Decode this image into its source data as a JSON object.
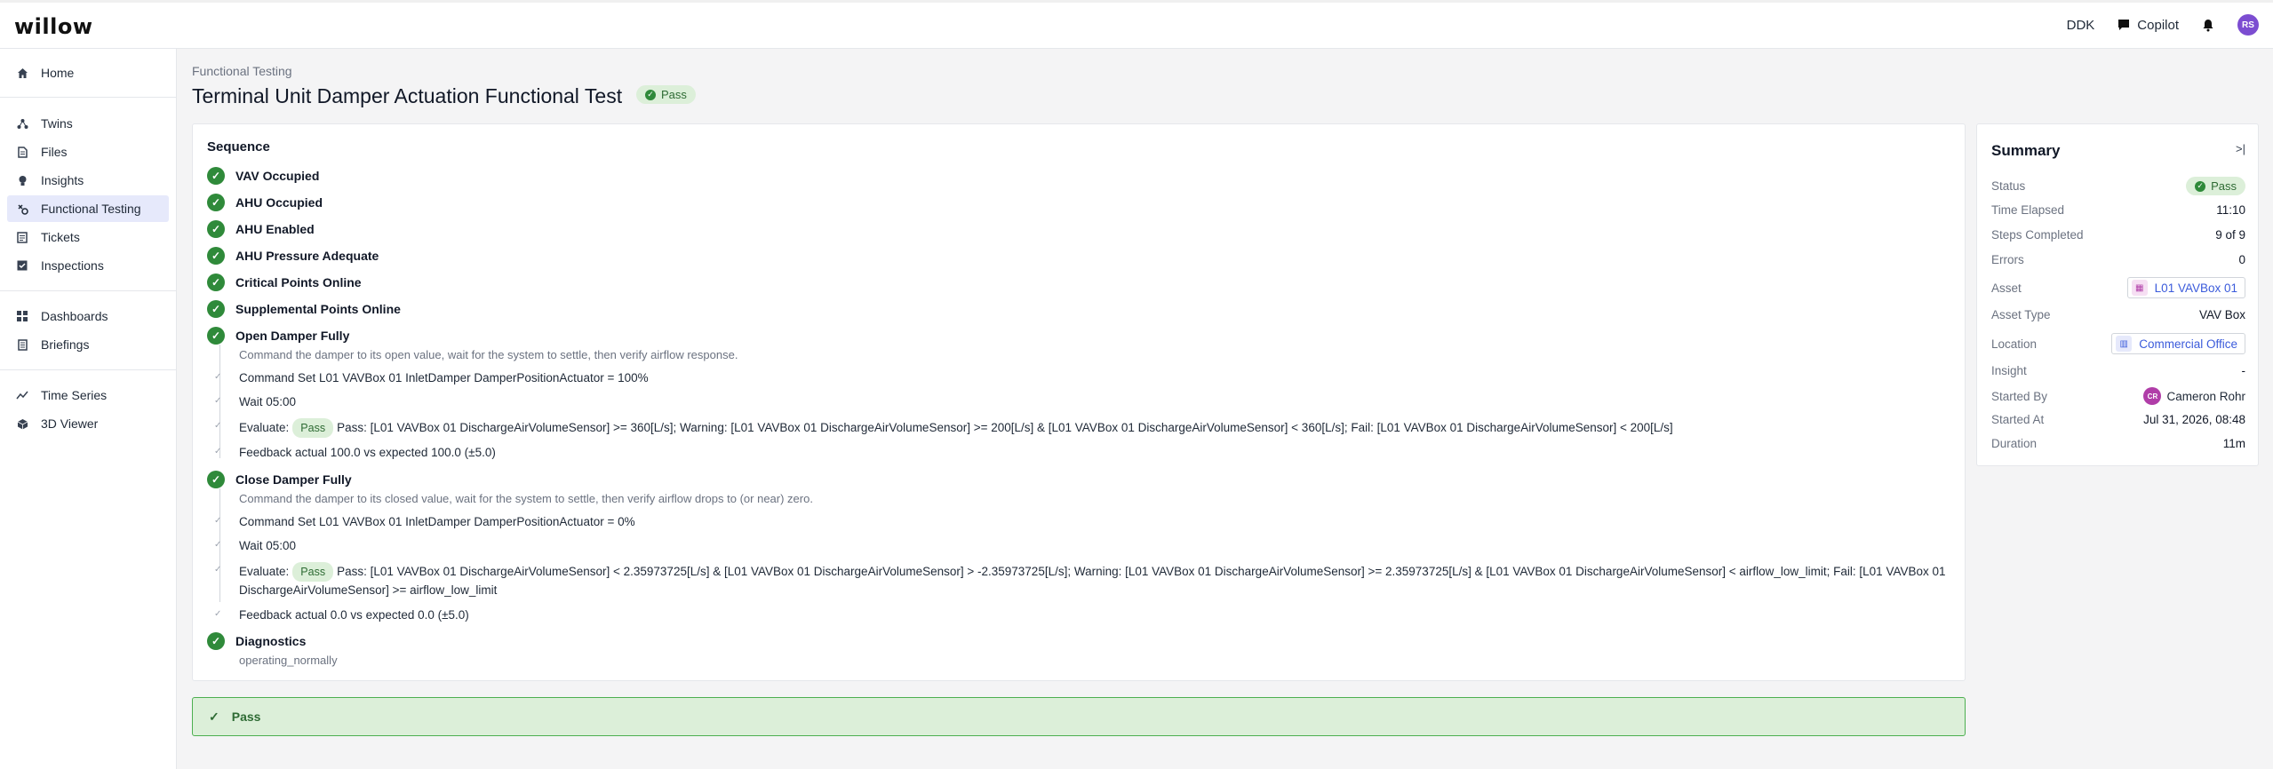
{
  "app": {
    "logo": "willow"
  },
  "topbar": {
    "site": "DDK",
    "copilot": "Copilot",
    "user_initials": "RS"
  },
  "sidebar": {
    "items": [
      {
        "label": "Home",
        "icon": "home-icon"
      },
      {
        "label": "Twins",
        "icon": "twins-icon"
      },
      {
        "label": "Files",
        "icon": "file-icon"
      },
      {
        "label": "Insights",
        "icon": "lightbulb-icon"
      },
      {
        "label": "Functional Testing",
        "icon": "functional-testing-icon",
        "active": true
      },
      {
        "label": "Tickets",
        "icon": "ticket-icon"
      },
      {
        "label": "Inspections",
        "icon": "checkbox-icon"
      },
      {
        "label": "Dashboards",
        "icon": "grid-icon"
      },
      {
        "label": "Briefings",
        "icon": "document-icon"
      },
      {
        "label": "Time Series",
        "icon": "line-chart-icon"
      },
      {
        "label": "3D Viewer",
        "icon": "cube-icon"
      }
    ]
  },
  "page": {
    "breadcrumb": "Functional Testing",
    "title": "Terminal Unit Damper Actuation Functional Test",
    "status": "Pass"
  },
  "sequence": {
    "title": "Sequence",
    "steps": [
      {
        "label": "VAV Occupied"
      },
      {
        "label": "AHU Occupied"
      },
      {
        "label": "AHU Enabled"
      },
      {
        "label": "AHU Pressure Adequate"
      },
      {
        "label": "Critical Points Online"
      },
      {
        "label": "Supplemental Points Online"
      },
      {
        "label": "Open Damper Fully",
        "description": "Command the damper to its open value, wait for the system to settle, then verify airflow response.",
        "subs": [
          "Command Set L01 VAVBox 01 InletDamper DamperPositionActuator = 100%",
          "Wait 05:00",
          "Pass: [L01 VAVBox 01 DischargeAirVolumeSensor] >= 360[L/s]; Warning: [L01 VAVBox 01 DischargeAirVolumeSensor] >= 200[L/s] & [L01 VAVBox 01 DischargeAirVolumeSensor] < 360[L/s]; Fail: [L01 VAVBox 01 DischargeAirVolumeSensor] < 200[L/s]",
          "Feedback actual 100.0 vs expected 100.0 (±5.0)"
        ]
      },
      {
        "label": "Close Damper Fully",
        "description": "Command the damper to its closed value, wait for the system to settle, then verify airflow drops to (or near) zero.",
        "subs": [
          "Command Set L01 VAVBox 01 InletDamper DamperPositionActuator = 0%",
          "Wait 05:00",
          "Pass: [L01 VAVBox 01 DischargeAirVolumeSensor] < 2.35973725[L/s] & [L01 VAVBox 01 DischargeAirVolumeSensor] > -2.35973725[L/s]; Warning: [L01 VAVBox 01 DischargeAirVolumeSensor] >= 2.35973725[L/s] & [L01 VAVBox 01 DischargeAirVolumeSensor] < airflow_low_limit; Fail: [L01 VAVBox 01 DischargeAirVolumeSensor] >= airflow_low_limit",
          "Feedback actual 0.0 vs expected 0.0 (±5.0)"
        ]
      },
      {
        "label": "Diagnostics",
        "description": "operating_normally"
      }
    ],
    "evaluate_label": "Evaluate:",
    "evaluate_status": "Pass"
  },
  "footer": {
    "status": "Pass"
  },
  "summary": {
    "title": "Summary",
    "rows": [
      {
        "label": "Status",
        "value": "Pass"
      },
      {
        "label": "Time Elapsed",
        "value": "11:10"
      },
      {
        "label": "Steps Completed",
        "value": "9 of 9"
      },
      {
        "label": "Errors",
        "value": "0"
      },
      {
        "label": "Asset",
        "value": "L01 VAVBox 01"
      },
      {
        "label": "Asset Type",
        "value": "VAV Box"
      },
      {
        "label": "Location",
        "value": "Commercial Office"
      },
      {
        "label": "Insight",
        "value": "-"
      },
      {
        "label": "Started By",
        "value": "Cameron Rohr",
        "initials": "CR"
      },
      {
        "label": "Started At",
        "value": "Jul 31, 2026, 08:48"
      },
      {
        "label": "Duration",
        "value": "11m"
      }
    ]
  },
  "colors": {
    "success": "#2f8a3a",
    "success_bg": "#dcefd9",
    "accent": "#3b5bdb",
    "avatar": "#7c4dd1"
  }
}
